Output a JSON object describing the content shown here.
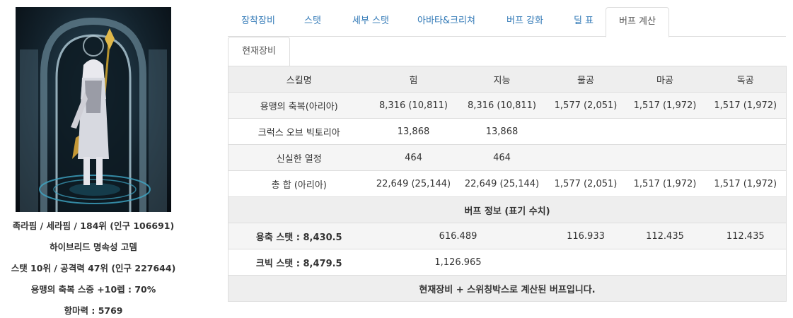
{
  "profile": {
    "lines": [
      "족라핌 / 세라핌 / 184위 (인구 106691)",
      "하이브리드 명속성 고뎀",
      "스탯 10위 / 공격력 47위 (인구 227644)",
      "용맹의 축복 스증 +10렙 : 70%",
      "항마력 : 5769"
    ]
  },
  "tabs": [
    {
      "label": "장착장비",
      "active": false
    },
    {
      "label": "스탯",
      "active": false
    },
    {
      "label": "세부 스탯",
      "active": false
    },
    {
      "label": "아바타&크리쳐",
      "active": false
    },
    {
      "label": "버프 강화",
      "active": false
    },
    {
      "label": "딜 표",
      "active": false
    },
    {
      "label": "버프 계산",
      "active": true
    }
  ],
  "subtab": {
    "label": "현재장비"
  },
  "table": {
    "headers": [
      "스킬명",
      "힘",
      "지능",
      "물공",
      "마공",
      "독공"
    ],
    "rows": [
      [
        "용맹의 축복(아리아)",
        "8,316 (10,811)",
        "8,316 (10,811)",
        "1,577 (2,051)",
        "1,517 (1,972)",
        "1,517 (1,972)"
      ],
      [
        "크럭스 오브 빅토리아",
        "13,868",
        "13,868",
        "",
        "",
        ""
      ],
      [
        "신실한 열정",
        "464",
        "464",
        "",
        "",
        ""
      ],
      [
        "총 합 (아리아)",
        "22,649 (25,144)",
        "22,649 (25,144)",
        "1,577 (2,051)",
        "1,517 (1,972)",
        "1,517 (1,972)"
      ]
    ],
    "info_title": "버프 정보 (표기 수치)",
    "stat_rows": [
      {
        "label": "용축 스탯 : 8,430.5",
        "value": "616.489",
        "phys": "116.933",
        "mag": "112.435",
        "ind": "112.435"
      },
      {
        "label": "크빅 스탯 : 8,479.5",
        "value": "1,126.965",
        "phys": "",
        "mag": "",
        "ind": ""
      }
    ],
    "footer": "현재장비 + 스위칭박스로 계산된 버프입니다."
  }
}
